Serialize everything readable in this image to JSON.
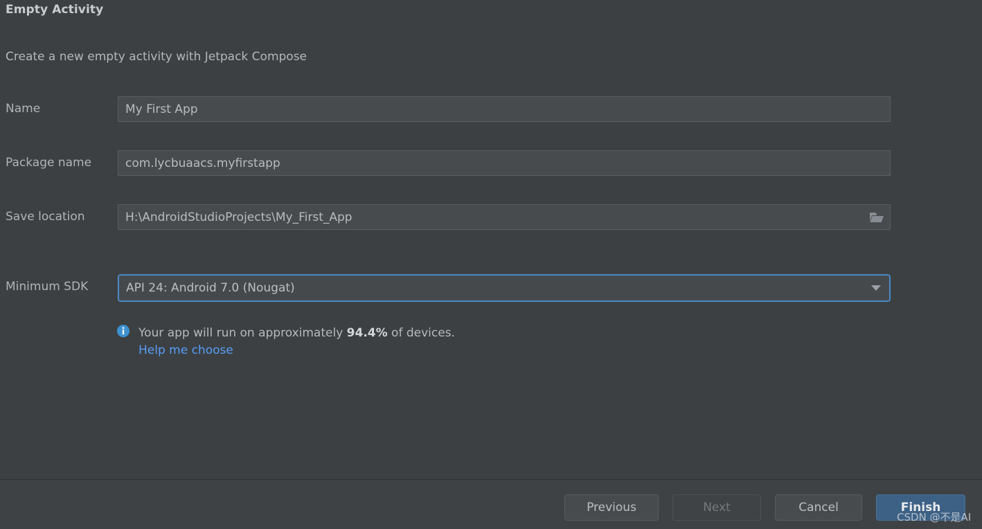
{
  "dialog": {
    "title": "Empty Activity",
    "subtitle": "Create a new empty activity with Jetpack Compose"
  },
  "form": {
    "name": {
      "label": "Name",
      "value": "My First App"
    },
    "package_name": {
      "label": "Package name",
      "value": "com.lycbuaacs.myfirstapp"
    },
    "save_location": {
      "label": "Save location",
      "value": "H:\\AndroidStudioProjects\\My_First_App",
      "browse_icon": "folder-open-icon"
    },
    "minimum_sdk": {
      "label": "Minimum SDK",
      "value": "API 24: Android 7.0 (Nougat)",
      "dropdown_icon": "chevron-down-icon"
    }
  },
  "info": {
    "icon": "info-circle-icon",
    "text_before": "Your app will run on approximately ",
    "percentage": "94.4%",
    "text_after": " of devices.",
    "help_link": "Help me choose"
  },
  "footer": {
    "buttons": [
      {
        "label": "Previous",
        "state": "enabled"
      },
      {
        "label": "Next",
        "state": "disabled"
      },
      {
        "label": "Cancel",
        "state": "enabled"
      },
      {
        "label": "Finish",
        "state": "primary"
      }
    ]
  },
  "watermark": "CSDN @不是AI",
  "colors": {
    "background": "#3c4043",
    "field_background": "#474b4e",
    "focus_border": "#4a88c7",
    "link": "#589df6",
    "primary_button": "#3d6185",
    "info_icon": "#3d91d1",
    "text": "#b4b8bb"
  }
}
